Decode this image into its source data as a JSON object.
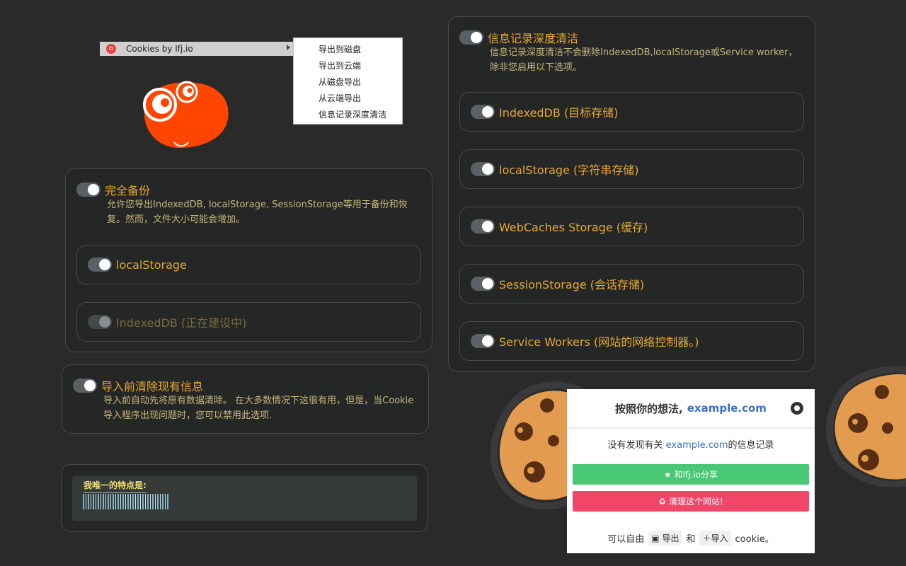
{
  "context_menu": {
    "parent_label": "Cookies by lfj.io",
    "items": [
      "导出到磁盘",
      "导出到云端",
      "从磁盘导出",
      "从云端导出",
      "信息记录深度清洁"
    ]
  },
  "backup": {
    "title": "完全备份",
    "desc": "允许您导出IndexedDB, localStorage, SessionStorage等用于备份和恢复。然而，文件大小可能会增加。",
    "options": [
      {
        "label": "localStorage",
        "enabled": true
      },
      {
        "label": "IndexedDB (正在建设中)",
        "enabled": false
      }
    ]
  },
  "clear_before_import": {
    "title": "导入前清除现有信息",
    "desc": "导入前自动先将原有数据清除。 在大多数情况下这很有用，但是，当Cookie导入程序出现问题时，您可以禁用此选项."
  },
  "feature": {
    "label": "我唯一的特点是:"
  },
  "deep_clean": {
    "title": "信息记录深度清洁",
    "desc": "信息记录深度清洁不会删除IndexedDB,localStorage或Service worker，除非您启用以下选项。",
    "options": [
      "IndexedDB (目标存储)",
      "localStorage (字符串存储)",
      "WebCaches Storage (缓存)",
      "SessionStorage (会话存储)",
      "Service Workers (网站的网络控制器。)"
    ]
  },
  "popup": {
    "title_prefix": "按照你的想法,",
    "domain": "example.com",
    "msg_prefix": "没有发现有关",
    "msg_domain": "example.com",
    "msg_suffix": "的信息记录",
    "share_label": "★ 和lfj.io分享",
    "clean_label": "清理这个网站!",
    "foot_prefix": "可以自由",
    "export_label": "导出",
    "and": "和",
    "import_label": "导入",
    "foot_suffix": "cookie。"
  },
  "colors": {
    "accent": "#e8a733",
    "green": "#48c774",
    "red": "#f14668",
    "link": "#3b73c4"
  }
}
